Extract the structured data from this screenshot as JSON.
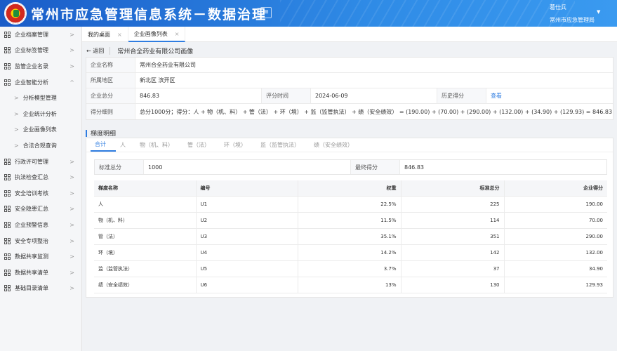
{
  "header": {
    "title": "常州市应急管理信息系统－数据治理",
    "menu_icon": "≡",
    "user_name": "葛仕兵",
    "user_org": "常州市应急管理局",
    "colors": {
      "accent": "#2f7de1",
      "header_start": "#1a5cc8",
      "header_end": "#3a9af0"
    }
  },
  "sidebar": {
    "items": [
      {
        "label": "企业档案管理",
        "arrow": ">"
      },
      {
        "label": "企业标签管理",
        "arrow": ">"
      },
      {
        "label": "监管企业名录",
        "arrow": ">"
      },
      {
        "label": "企业智能分析",
        "arrow": "^"
      },
      {
        "label": "分析模型管理",
        "sub": true
      },
      {
        "label": "企业统计分析",
        "sub": true
      },
      {
        "label": "企业画像列表",
        "sub": true
      },
      {
        "label": "合法合规查询",
        "sub": true
      },
      {
        "label": "行政许可管理",
        "arrow": ">"
      },
      {
        "label": "执法检查汇总",
        "arrow": ">"
      },
      {
        "label": "安全培训考核",
        "arrow": ">"
      },
      {
        "label": "安全隐患汇总",
        "arrow": ">"
      },
      {
        "label": "企业预警信息",
        "arrow": ">"
      },
      {
        "label": "安全专项整治",
        "arrow": ">"
      },
      {
        "label": "数据共享监测",
        "arrow": ">"
      },
      {
        "label": "数据共享清单",
        "arrow": ">"
      },
      {
        "label": "基础目录清单",
        "arrow": ">"
      }
    ]
  },
  "tabs": [
    {
      "label": "我的桌面",
      "close": "×"
    },
    {
      "label": "企业画像列表",
      "close": "×"
    }
  ],
  "page": {
    "back_label": "← 返回",
    "title": "常州合全药业有限公司画像"
  },
  "info": {
    "company_name_label": "企业名称",
    "company_name": "常州合全药业有限公司",
    "region_label": "所属地区",
    "region": "新北区 滨开区",
    "total_score_label": "企业总分",
    "total_score": "846.83",
    "eval_time_label": "评分时间",
    "eval_time": "2024-06-09",
    "history_label": "历史得分",
    "history_link": "查看",
    "detail_label": "得分细则",
    "detail": "总分1000分；得分：人 + 物（机、料） + 管（法） + 环（境） + 监（监管执法） + 绩（安全绩效） = (190.00) + (70.00) + (290.00) + (132.00) + (34.90) + (129.93) = 846.83"
  },
  "section": {
    "title": "梯度明细"
  },
  "subtabs": [
    "合计",
    "人",
    "物（机、料）",
    "管（法）",
    "环（境）",
    "监（监管执法）",
    "绩（安全绩效）"
  ],
  "score_summary": {
    "standard_label": "标准总分",
    "standard": "1000",
    "final_label": "最终得分",
    "final": "846.83"
  },
  "table": {
    "headers": [
      "梯度名称",
      "编号",
      "权重",
      "标准总分",
      "企业得分"
    ],
    "rows": [
      [
        "人",
        "U1",
        "22.5%",
        "225",
        "190.00"
      ],
      [
        "物（机、料）",
        "U2",
        "11.5%",
        "114",
        "70.00"
      ],
      [
        "管（法）",
        "U3",
        "35.1%",
        "351",
        "290.00"
      ],
      [
        "环（境）",
        "U4",
        "14.2%",
        "142",
        "132.00"
      ],
      [
        "监（监管执法）",
        "U5",
        "3.7%",
        "37",
        "34.90"
      ],
      [
        "绩（安全绩效）",
        "U6",
        "13%",
        "130",
        "129.93"
      ]
    ]
  }
}
